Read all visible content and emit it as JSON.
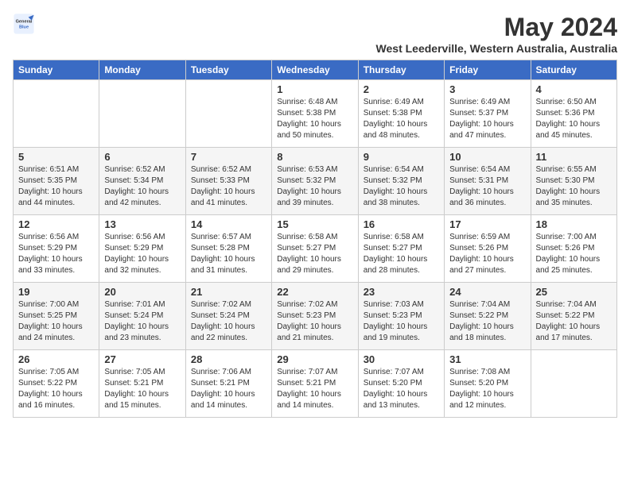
{
  "logo": {
    "line1": "General",
    "line2": "Blue"
  },
  "calendar": {
    "title": "May 2024",
    "subtitle": "West Leederville, Western Australia, Australia",
    "headers": [
      "Sunday",
      "Monday",
      "Tuesday",
      "Wednesday",
      "Thursday",
      "Friday",
      "Saturday"
    ],
    "weeks": [
      [
        {
          "day": "",
          "info": ""
        },
        {
          "day": "",
          "info": ""
        },
        {
          "day": "",
          "info": ""
        },
        {
          "day": "1",
          "info": "Sunrise: 6:48 AM\nSunset: 5:38 PM\nDaylight: 10 hours\nand 50 minutes."
        },
        {
          "day": "2",
          "info": "Sunrise: 6:49 AM\nSunset: 5:38 PM\nDaylight: 10 hours\nand 48 minutes."
        },
        {
          "day": "3",
          "info": "Sunrise: 6:49 AM\nSunset: 5:37 PM\nDaylight: 10 hours\nand 47 minutes."
        },
        {
          "day": "4",
          "info": "Sunrise: 6:50 AM\nSunset: 5:36 PM\nDaylight: 10 hours\nand 45 minutes."
        }
      ],
      [
        {
          "day": "5",
          "info": "Sunrise: 6:51 AM\nSunset: 5:35 PM\nDaylight: 10 hours\nand 44 minutes."
        },
        {
          "day": "6",
          "info": "Sunrise: 6:52 AM\nSunset: 5:34 PM\nDaylight: 10 hours\nand 42 minutes."
        },
        {
          "day": "7",
          "info": "Sunrise: 6:52 AM\nSunset: 5:33 PM\nDaylight: 10 hours\nand 41 minutes."
        },
        {
          "day": "8",
          "info": "Sunrise: 6:53 AM\nSunset: 5:32 PM\nDaylight: 10 hours\nand 39 minutes."
        },
        {
          "day": "9",
          "info": "Sunrise: 6:54 AM\nSunset: 5:32 PM\nDaylight: 10 hours\nand 38 minutes."
        },
        {
          "day": "10",
          "info": "Sunrise: 6:54 AM\nSunset: 5:31 PM\nDaylight: 10 hours\nand 36 minutes."
        },
        {
          "day": "11",
          "info": "Sunrise: 6:55 AM\nSunset: 5:30 PM\nDaylight: 10 hours\nand 35 minutes."
        }
      ],
      [
        {
          "day": "12",
          "info": "Sunrise: 6:56 AM\nSunset: 5:29 PM\nDaylight: 10 hours\nand 33 minutes."
        },
        {
          "day": "13",
          "info": "Sunrise: 6:56 AM\nSunset: 5:29 PM\nDaylight: 10 hours\nand 32 minutes."
        },
        {
          "day": "14",
          "info": "Sunrise: 6:57 AM\nSunset: 5:28 PM\nDaylight: 10 hours\nand 31 minutes."
        },
        {
          "day": "15",
          "info": "Sunrise: 6:58 AM\nSunset: 5:27 PM\nDaylight: 10 hours\nand 29 minutes."
        },
        {
          "day": "16",
          "info": "Sunrise: 6:58 AM\nSunset: 5:27 PM\nDaylight: 10 hours\nand 28 minutes."
        },
        {
          "day": "17",
          "info": "Sunrise: 6:59 AM\nSunset: 5:26 PM\nDaylight: 10 hours\nand 27 minutes."
        },
        {
          "day": "18",
          "info": "Sunrise: 7:00 AM\nSunset: 5:26 PM\nDaylight: 10 hours\nand 25 minutes."
        }
      ],
      [
        {
          "day": "19",
          "info": "Sunrise: 7:00 AM\nSunset: 5:25 PM\nDaylight: 10 hours\nand 24 minutes."
        },
        {
          "day": "20",
          "info": "Sunrise: 7:01 AM\nSunset: 5:24 PM\nDaylight: 10 hours\nand 23 minutes."
        },
        {
          "day": "21",
          "info": "Sunrise: 7:02 AM\nSunset: 5:24 PM\nDaylight: 10 hours\nand 22 minutes."
        },
        {
          "day": "22",
          "info": "Sunrise: 7:02 AM\nSunset: 5:23 PM\nDaylight: 10 hours\nand 21 minutes."
        },
        {
          "day": "23",
          "info": "Sunrise: 7:03 AM\nSunset: 5:23 PM\nDaylight: 10 hours\nand 19 minutes."
        },
        {
          "day": "24",
          "info": "Sunrise: 7:04 AM\nSunset: 5:22 PM\nDaylight: 10 hours\nand 18 minutes."
        },
        {
          "day": "25",
          "info": "Sunrise: 7:04 AM\nSunset: 5:22 PM\nDaylight: 10 hours\nand 17 minutes."
        }
      ],
      [
        {
          "day": "26",
          "info": "Sunrise: 7:05 AM\nSunset: 5:22 PM\nDaylight: 10 hours\nand 16 minutes."
        },
        {
          "day": "27",
          "info": "Sunrise: 7:05 AM\nSunset: 5:21 PM\nDaylight: 10 hours\nand 15 minutes."
        },
        {
          "day": "28",
          "info": "Sunrise: 7:06 AM\nSunset: 5:21 PM\nDaylight: 10 hours\nand 14 minutes."
        },
        {
          "day": "29",
          "info": "Sunrise: 7:07 AM\nSunset: 5:21 PM\nDaylight: 10 hours\nand 14 minutes."
        },
        {
          "day": "30",
          "info": "Sunrise: 7:07 AM\nSunset: 5:20 PM\nDaylight: 10 hours\nand 13 minutes."
        },
        {
          "day": "31",
          "info": "Sunrise: 7:08 AM\nSunset: 5:20 PM\nDaylight: 10 hours\nand 12 minutes."
        },
        {
          "day": "",
          "info": ""
        }
      ]
    ]
  }
}
